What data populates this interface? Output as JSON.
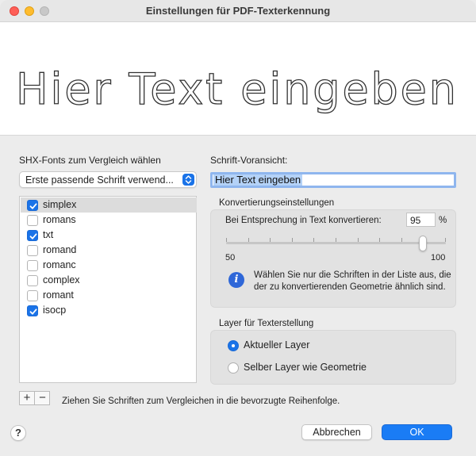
{
  "window": {
    "title": "Einstellungen für PDF-Texterkennung"
  },
  "preview": {
    "text": "Hier Text eingeben"
  },
  "left_panel": {
    "heading": "SHX-Fonts zum Vergleich wählen",
    "popup_value": "Erste passende Schrift verwend...",
    "fonts": [
      {
        "label": "simplex",
        "checked": true,
        "selected": true
      },
      {
        "label": "romans",
        "checked": false,
        "selected": false
      },
      {
        "label": "txt",
        "checked": true,
        "selected": false
      },
      {
        "label": "romand",
        "checked": false,
        "selected": false
      },
      {
        "label": "romanc",
        "checked": false,
        "selected": false
      },
      {
        "label": "complex",
        "checked": false,
        "selected": false
      },
      {
        "label": "romant",
        "checked": false,
        "selected": false
      },
      {
        "label": "isocp",
        "checked": true,
        "selected": false
      }
    ],
    "add_label": "+",
    "remove_label": "−",
    "hint": "Ziehen Sie Schriften zum Vergleichen in die bevorzugte Reihenfolge."
  },
  "right_panel": {
    "preview_heading": "Schrift-Voransicht:",
    "preview_field_value": "Hier Text eingeben",
    "conversion": {
      "heading": "Konvertierungseinstellungen",
      "match_label": "Bei Entsprechung in Text konvertieren:",
      "match_value": "95",
      "percent_sign": "%",
      "slider_min": "50",
      "slider_max": "100",
      "slider_value": 95,
      "info_text": "Wählen Sie nur die Schriften in der Liste aus, die der zu konvertierenden Geometrie ähnlich sind."
    },
    "layer": {
      "heading": "Layer für Texterstellung",
      "options": [
        {
          "label": "Aktueller Layer",
          "selected": true
        },
        {
          "label": "Selber Layer wie Geometrie",
          "selected": false
        }
      ]
    }
  },
  "footer": {
    "help_label": "?",
    "cancel_label": "Abbrechen",
    "ok_label": "OK"
  },
  "colors": {
    "accent": "#1a73e8",
    "info_icon": "#2f67d8"
  }
}
